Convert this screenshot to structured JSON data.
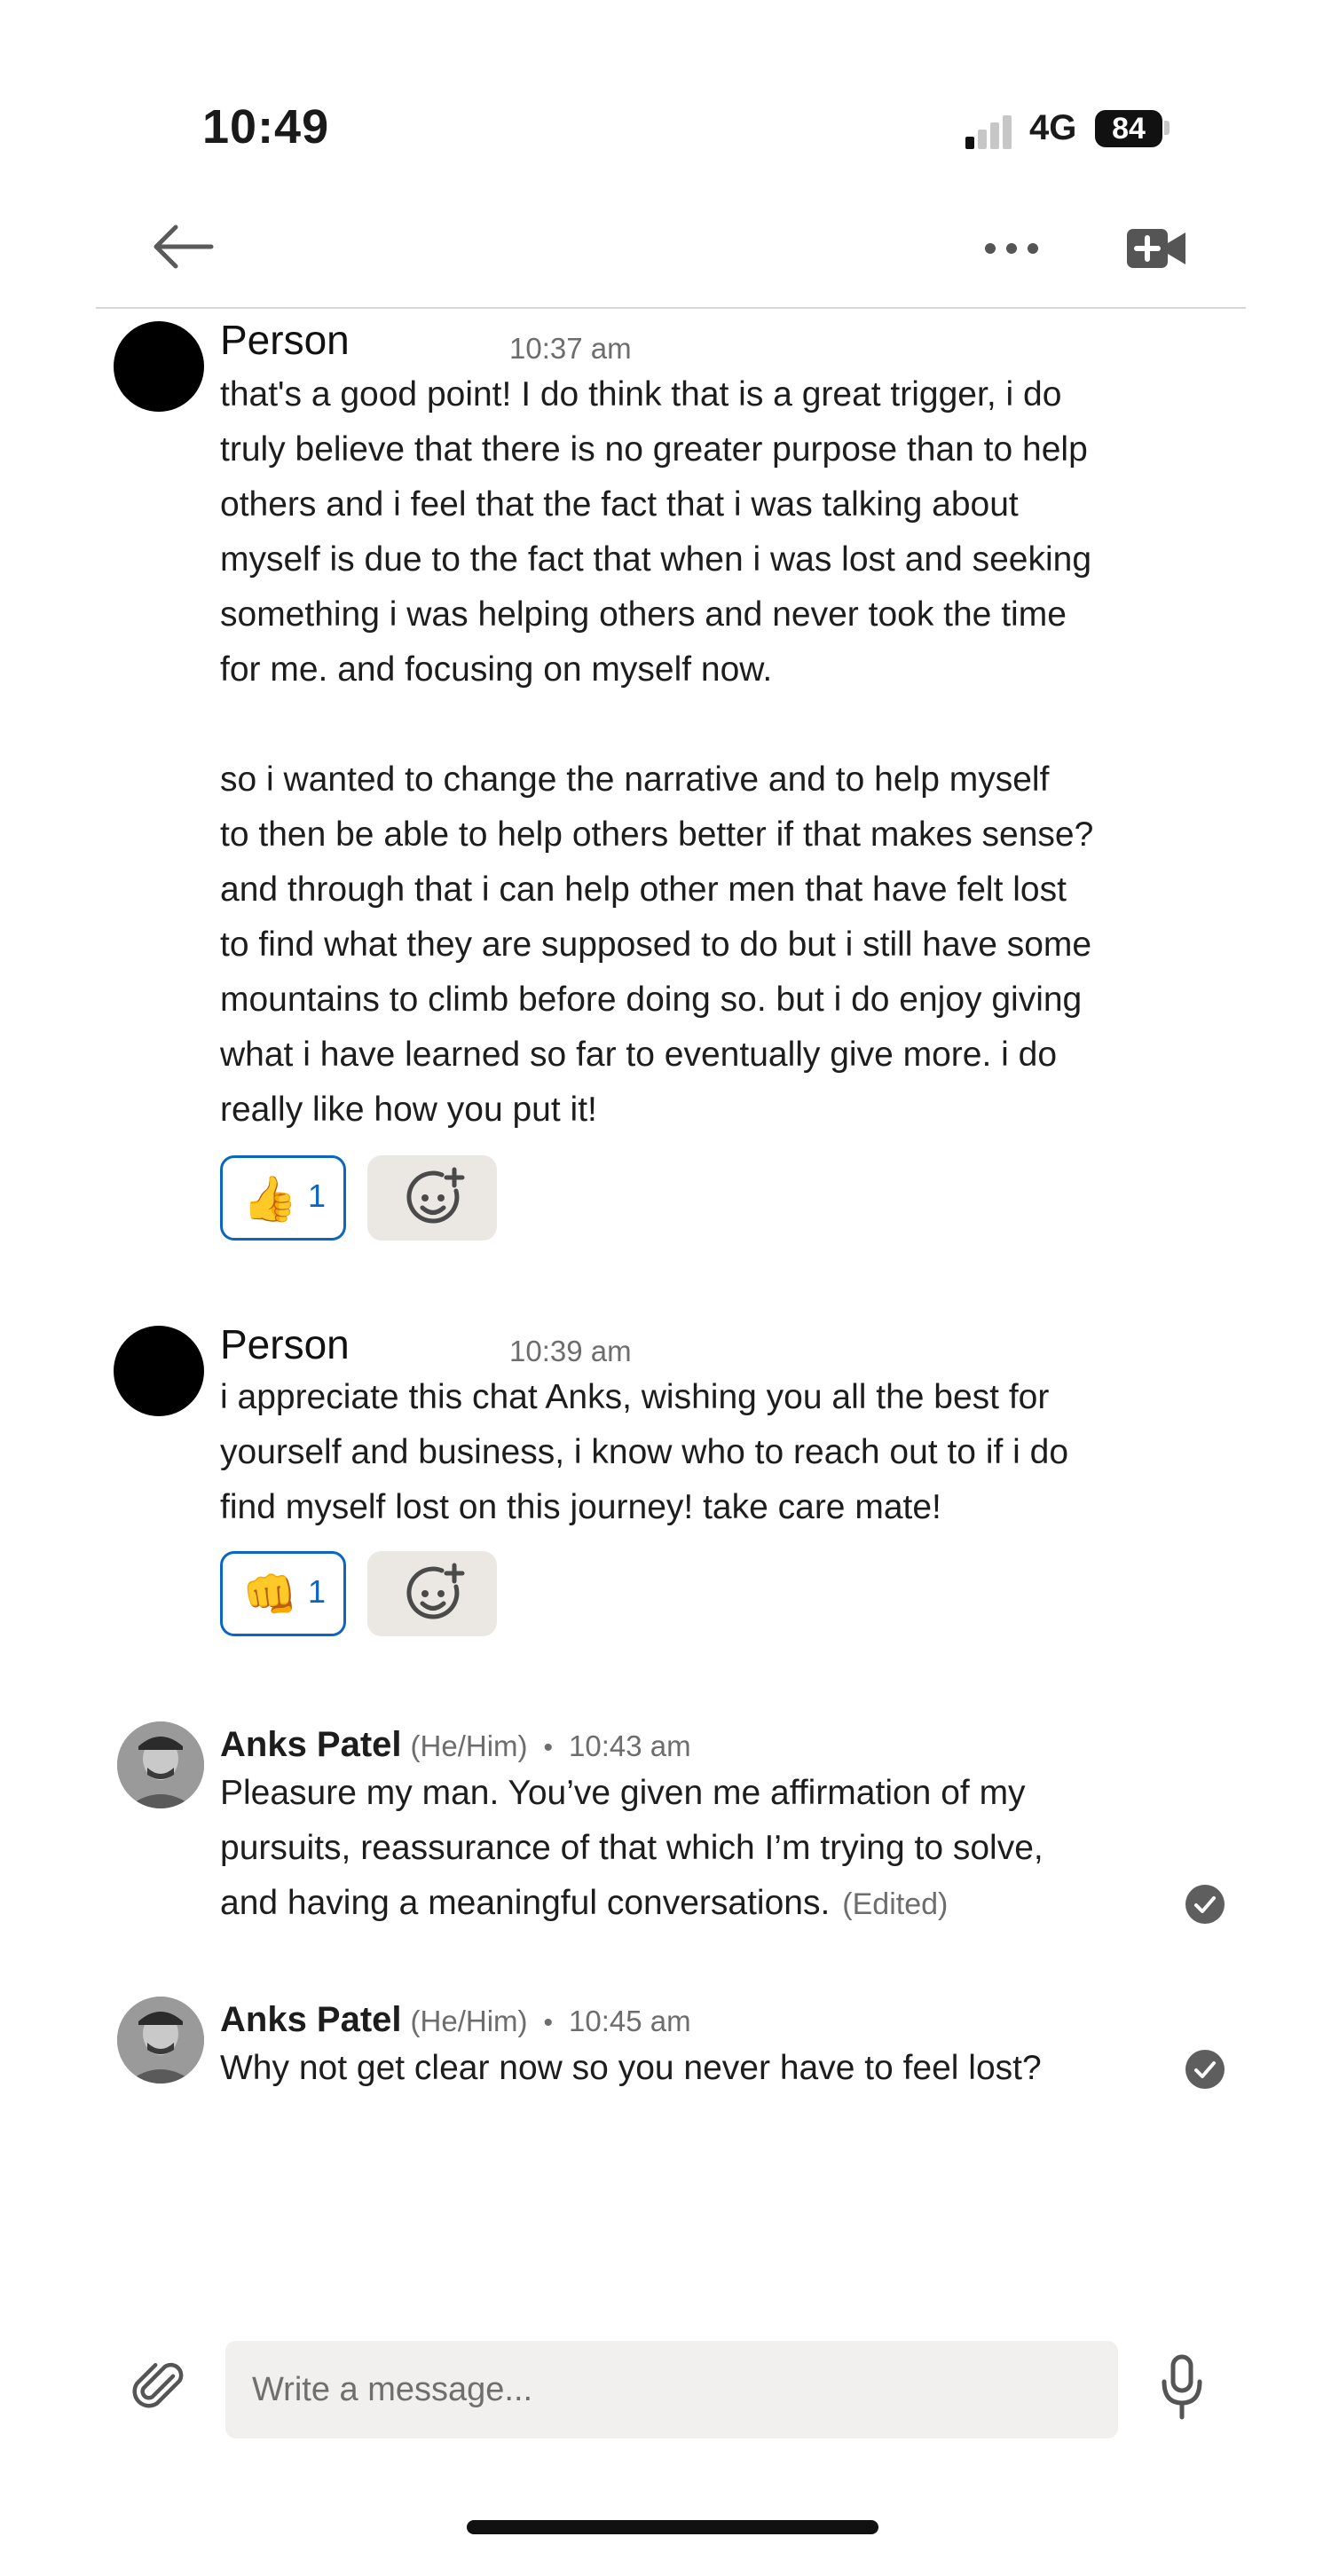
{
  "status_bar": {
    "time": "10:49",
    "network": "4G",
    "battery": "84"
  },
  "nav": {
    "back_icon": "arrow-left-icon",
    "more_icon": "ellipsis-icon",
    "video_icon": "video-call-add-icon"
  },
  "messages": [
    {
      "sender": "Person",
      "time": "10:37 am",
      "text": "that's a good point! I do think that is a great trigger, i do\ntruly believe that there is no greater purpose than to help\nothers and i feel that the fact that i was talking about\nmyself is due to the fact that when i was lost and seeking\nsomething  i was helping others and never took the time\nfor me. and focusing on myself now.\n\n so i wanted  to change the narrative and to help myself\nto then be able to help others better if that makes sense?\nand through that i can help other men that have felt lost\nto find what they are supposed to do but i still have some\nmountains to climb before doing so. but i do enjoy giving\nwhat i have learned so far to eventually give more. i do\nreally like how you put it!",
      "reaction": {
        "emoji": "👍",
        "count": "1"
      }
    },
    {
      "sender": "Person",
      "time": "10:39 am",
      "text": "i appreciate this chat Anks, wishing you all the best for\nyourself and business, i know who to reach out to if i do\nfind myself lost on this journey! take care mate!",
      "reaction": {
        "emoji": "👊",
        "count": "1"
      }
    },
    {
      "sender": "Anks Patel",
      "pronouns": "(He/Him)",
      "separator": "•",
      "time": "10:43 am",
      "text": "Pleasure my man. You’ve given me affirmation of my\npursuits, reassurance of that which I’m trying to solve,\nand having a meaningful conversations.",
      "edited": "(Edited)",
      "status_icon": "read-check-icon"
    },
    {
      "sender": "Anks Patel",
      "pronouns": "(He/Him)",
      "separator": "•",
      "time": "10:45 am",
      "text": "Why not get clear now so you never have to feel lost?",
      "status_icon": "read-check-icon"
    }
  ],
  "composer": {
    "placeholder": "Write a message...",
    "attach_icon": "paperclip-icon",
    "mic_icon": "microphone-icon"
  },
  "colors": {
    "accent": "#0a66c2",
    "reaction_bg": "#ebe7e2",
    "input_bg": "#f1f0ee"
  }
}
